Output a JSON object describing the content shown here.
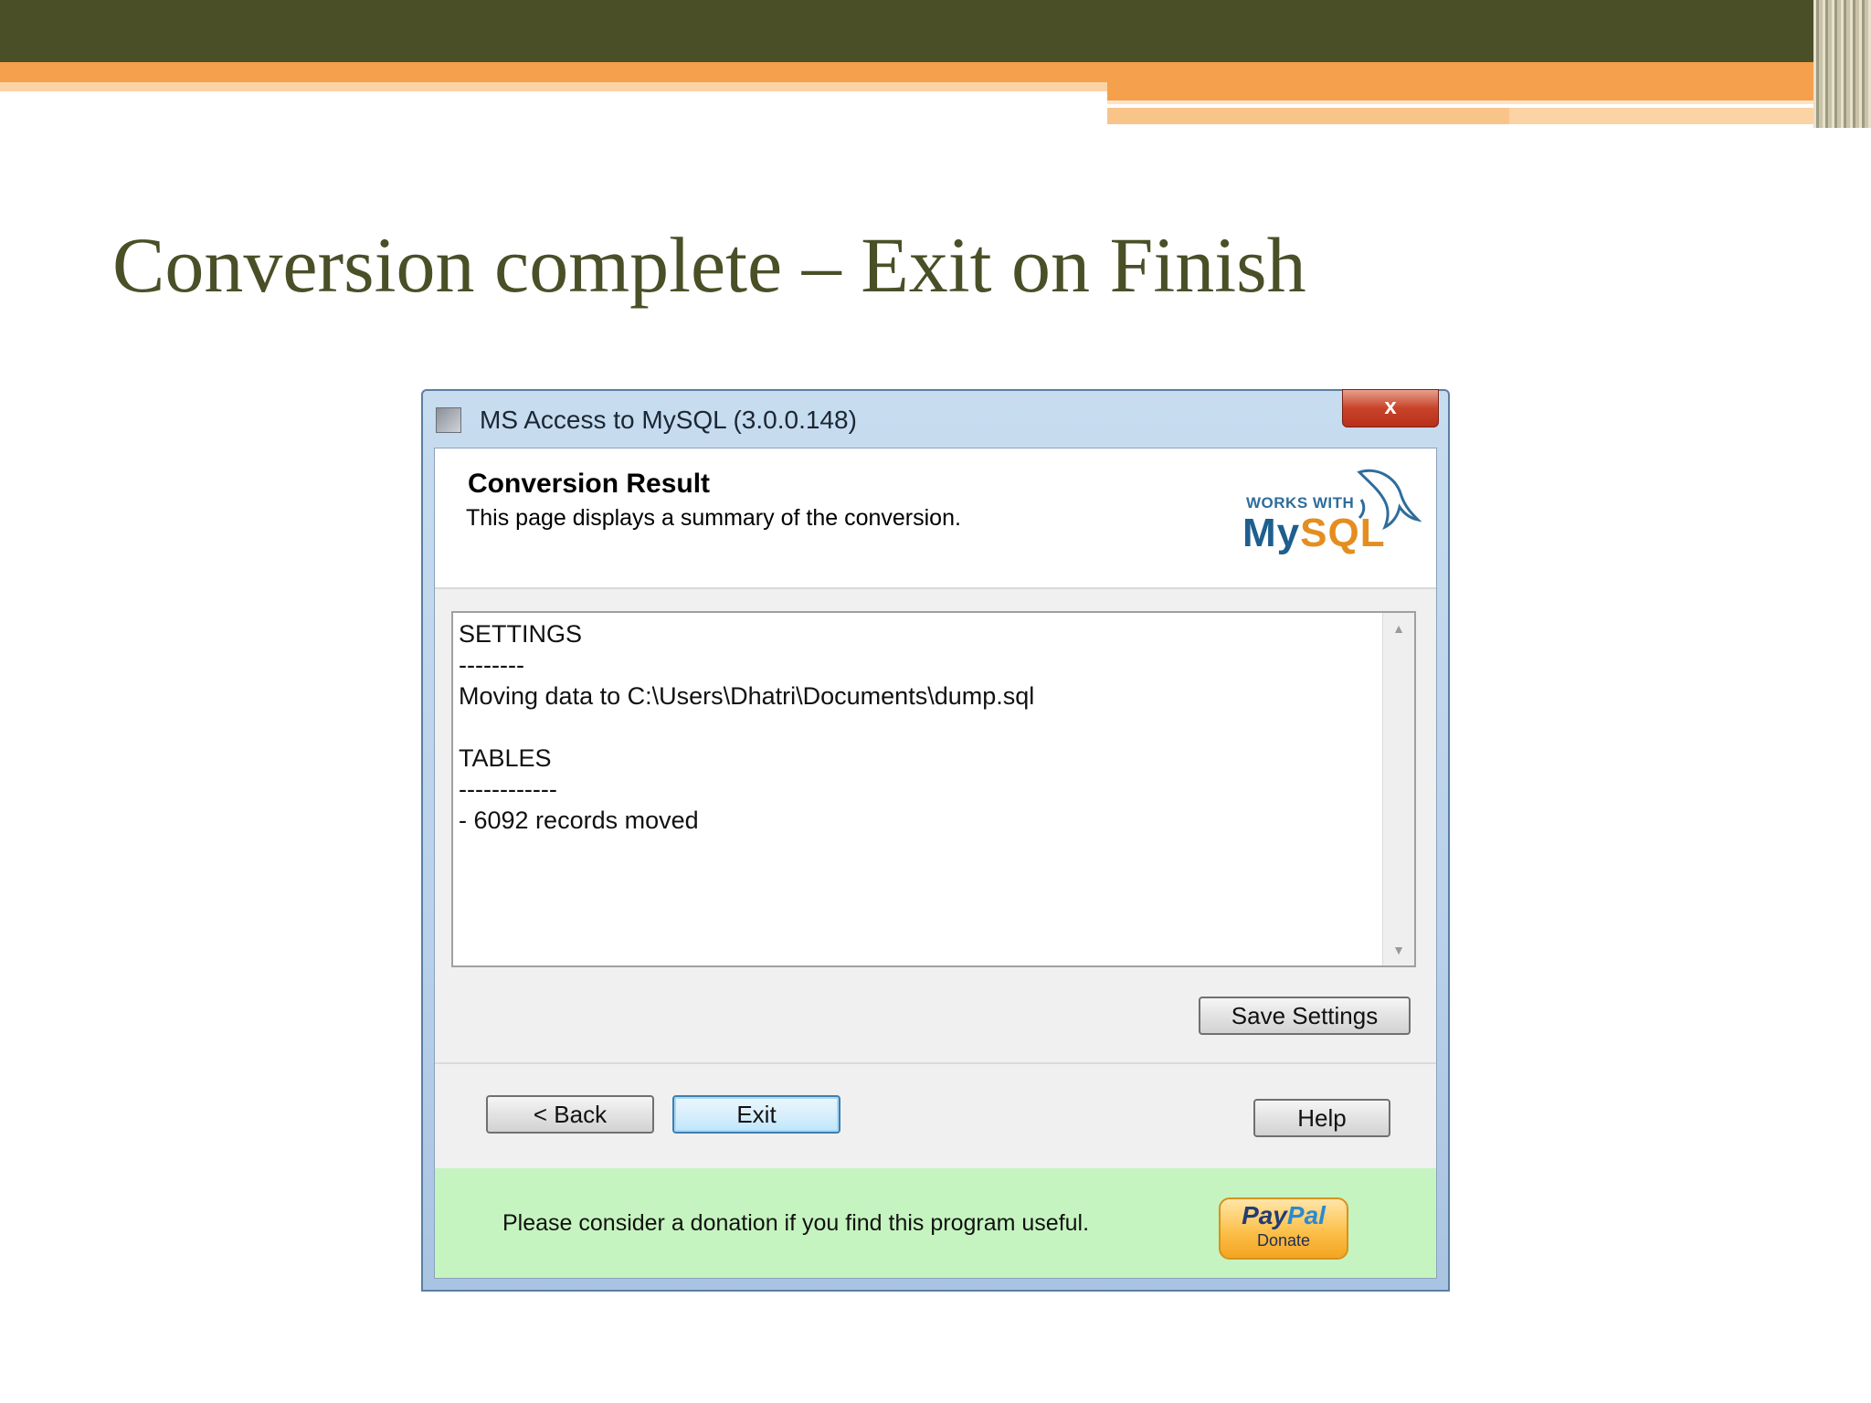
{
  "slide": {
    "title": "Conversion complete – Exit on Finish"
  },
  "window": {
    "title": "MS Access to MySQL (3.0.0.148)",
    "close_label": "x"
  },
  "header": {
    "title": "Conversion Result",
    "subtitle": "This page displays a summary of the conversion.",
    "logo_works_with": "WORKS WITH",
    "logo_my": "My",
    "logo_sql": "SQL"
  },
  "summary": {
    "lines": [
      "SETTINGS",
      "--------",
      "Moving data to C:\\Users\\Dhatri\\Documents\\dump.sql",
      "",
      "TABLES",
      "------------",
      "- 6092 records moved"
    ]
  },
  "buttons": {
    "save_settings": "Save Settings",
    "back": "< Back",
    "exit": "Exit",
    "help": "Help"
  },
  "donation": {
    "text": "Please consider a donation if you find this program useful.",
    "paypal_pay": "Pay",
    "paypal_pal": "Pal",
    "paypal_donate": "Donate"
  },
  "colors": {
    "slide_bar": "#4a4f27",
    "slide_accent": "#f5a04c",
    "donation_bg": "#c6f4c0",
    "default_button_border": "#3c7fb1"
  }
}
